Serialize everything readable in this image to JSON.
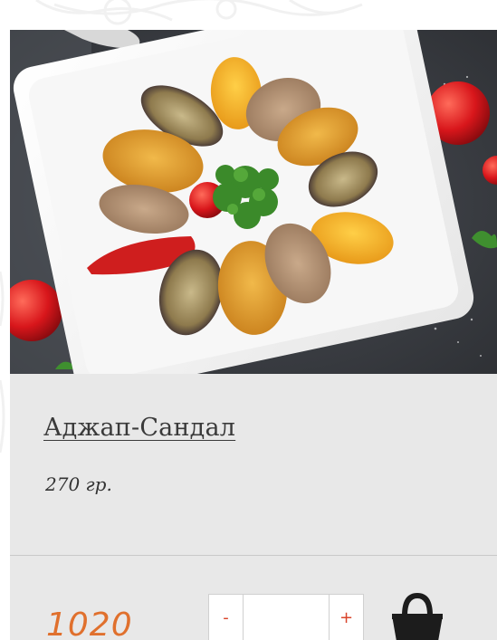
{
  "product": {
    "image_alt": "Аджап-Сандал",
    "title": "Аджап-Сандал",
    "weight": "270 гр.",
    "price": "1020",
    "quantity": {
      "minus_label": "-",
      "plus_label": "+",
      "value": ""
    }
  },
  "icons": {
    "cart": "shopping-basket-icon"
  },
  "colors": {
    "card_background": "#e8e8e8",
    "price": "#e0702d",
    "qty_button": "#d9442b",
    "title": "#3a3a3a"
  }
}
